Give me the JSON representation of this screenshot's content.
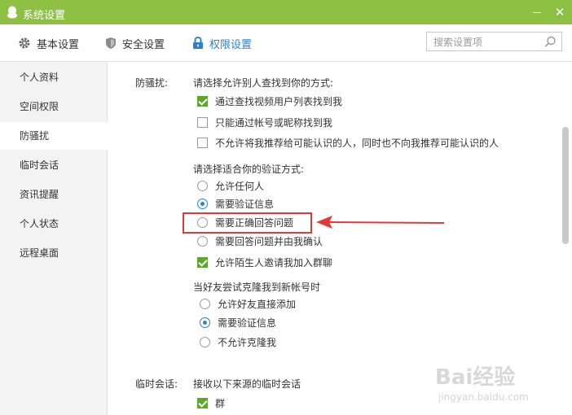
{
  "window": {
    "title": "系统设置",
    "close_glyph": "✕",
    "accent": "#8dc043"
  },
  "toolbar": {
    "tabs": [
      {
        "label": "基本设置",
        "icon": "gear-icon"
      },
      {
        "label": "安全设置",
        "icon": "shield-icon"
      },
      {
        "label": "权限设置",
        "icon": "lock-icon",
        "active": true
      }
    ],
    "search_placeholder": "搜索设置项"
  },
  "sidebar": {
    "items": [
      {
        "label": "个人资料"
      },
      {
        "label": "空间权限"
      },
      {
        "label": "防骚扰",
        "active": true
      },
      {
        "label": "临时会话"
      },
      {
        "label": "资讯提醒"
      },
      {
        "label": "个人状态"
      },
      {
        "label": "远程桌面"
      }
    ]
  },
  "anti_harass": {
    "section_label": "防骚扰:",
    "find_prompt": "请选择允许别人查找到你的方式:",
    "find_options": [
      {
        "label": "通过查找视频用户列表找到我",
        "checked": true
      },
      {
        "label": "只能通过帐号或昵称找到我",
        "checked": false
      },
      {
        "label": "不允许将我推荐给可能认识的人，同时也不向我推荐可能认识的人",
        "checked": false
      }
    ],
    "verify_prompt": "请选择适合你的验证方式:",
    "verify_options": [
      {
        "label": "允许任何人",
        "checked": false
      },
      {
        "label": "需要验证信息",
        "checked": true
      },
      {
        "label": "需要正确回答问题",
        "checked": false
      },
      {
        "label": "需要回答问题并由我确认",
        "checked": false
      }
    ],
    "group_invite": {
      "label": "允许陌生人邀请我加入群聊",
      "checked": true
    },
    "clone_prompt": "当好友尝试克隆我到新帐号时",
    "clone_options": [
      {
        "label": "允许好友直接添加",
        "checked": false
      },
      {
        "label": "需要验证信息",
        "checked": true
      },
      {
        "label": "不允许克隆我",
        "checked": false
      }
    ]
  },
  "temp_chat": {
    "section_label": "临时会话:",
    "prompt": "接收以下来源的临时会话",
    "options": [
      {
        "label": "群",
        "checked": true
      }
    ]
  },
  "watermark": {
    "brand": "Bai经验",
    "url": "jingyan.baidu.com"
  }
}
